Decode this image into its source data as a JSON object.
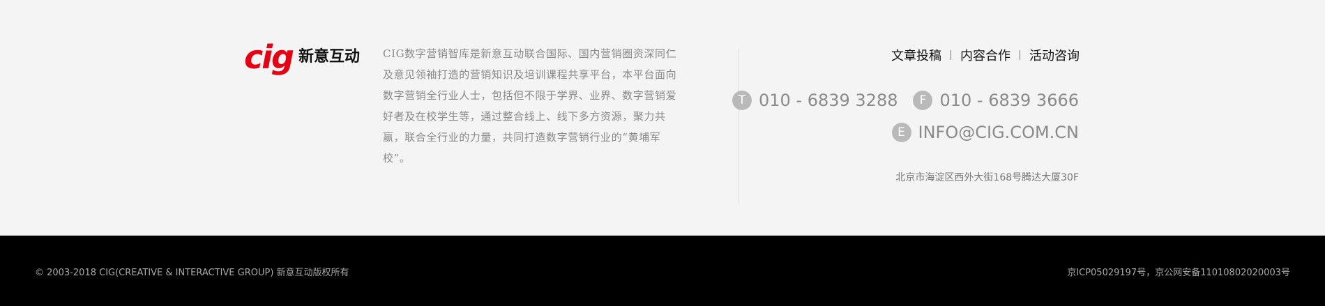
{
  "brand": {
    "logo_mark": "cig",
    "logo_text": "新意互动",
    "accent_color": "#e60012"
  },
  "intro": {
    "text": "CIG数字营销智库是新意互动联合国际、国内营销圈资深同仁及意见领袖打造的营销知识及培训课程共享平台，本平台面向数字营销全行业人士，包括但不限于学界、业界、数字营销爱好者及在校学生等，通过整合线上、线下多方资源，聚力共赢，联合全行业的力量，共同打造数字营销行业的“黄埔军校”。"
  },
  "links": [
    {
      "label": "文章投稿"
    },
    {
      "label": "内容合作"
    },
    {
      "label": "活动咨询"
    }
  ],
  "contact": {
    "tel": {
      "badge": "T",
      "value": "010 - 6839 3288"
    },
    "fax": {
      "badge": "F",
      "value": "010 - 6839 3666"
    },
    "email": {
      "badge": "E",
      "value": "INFO@CIG.COM.CN"
    },
    "address": "北京市海淀区西外大街168号腾达大厦30F"
  },
  "footer": {
    "copyright": "© 2003-2018 CIG(CREATIVE & INTERACTIVE GROUP) 新意互动版权所有",
    "icp": "京ICP05029197号，京公网安备11010802020003号"
  }
}
